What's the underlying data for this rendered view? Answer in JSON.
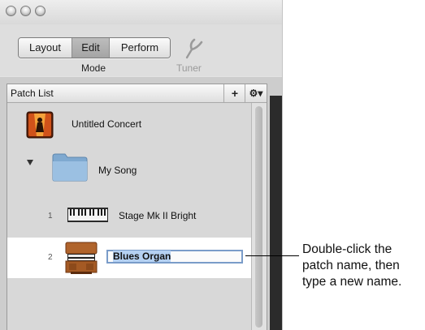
{
  "window": {
    "mode_buttons": [
      {
        "label": "Layout"
      },
      {
        "label": "Edit",
        "selected": true
      },
      {
        "label": "Perform"
      }
    ],
    "mode_label": "Mode",
    "tuner_label": "Tuner"
  },
  "patch_list": {
    "title": "Patch List",
    "add_button": "+",
    "action_button": "⚙▾",
    "concert": {
      "name": "Untitled Concert",
      "icon": "concert-icon"
    },
    "song": {
      "name": "My Song",
      "icon": "folder-icon"
    },
    "patches": [
      {
        "number": "1",
        "name": "Stage Mk II Bright",
        "icon": "electric-piano-icon"
      },
      {
        "number": "2",
        "name": "Blues Organ",
        "icon": "organ-icon",
        "editing": true
      }
    ]
  },
  "callout": {
    "line1": "Double-click the",
    "line2": "patch name, then",
    "line3": "type a new name."
  },
  "colors": {
    "selection_border": "#7a9cc9",
    "text_selection": "#b5d1f2"
  }
}
